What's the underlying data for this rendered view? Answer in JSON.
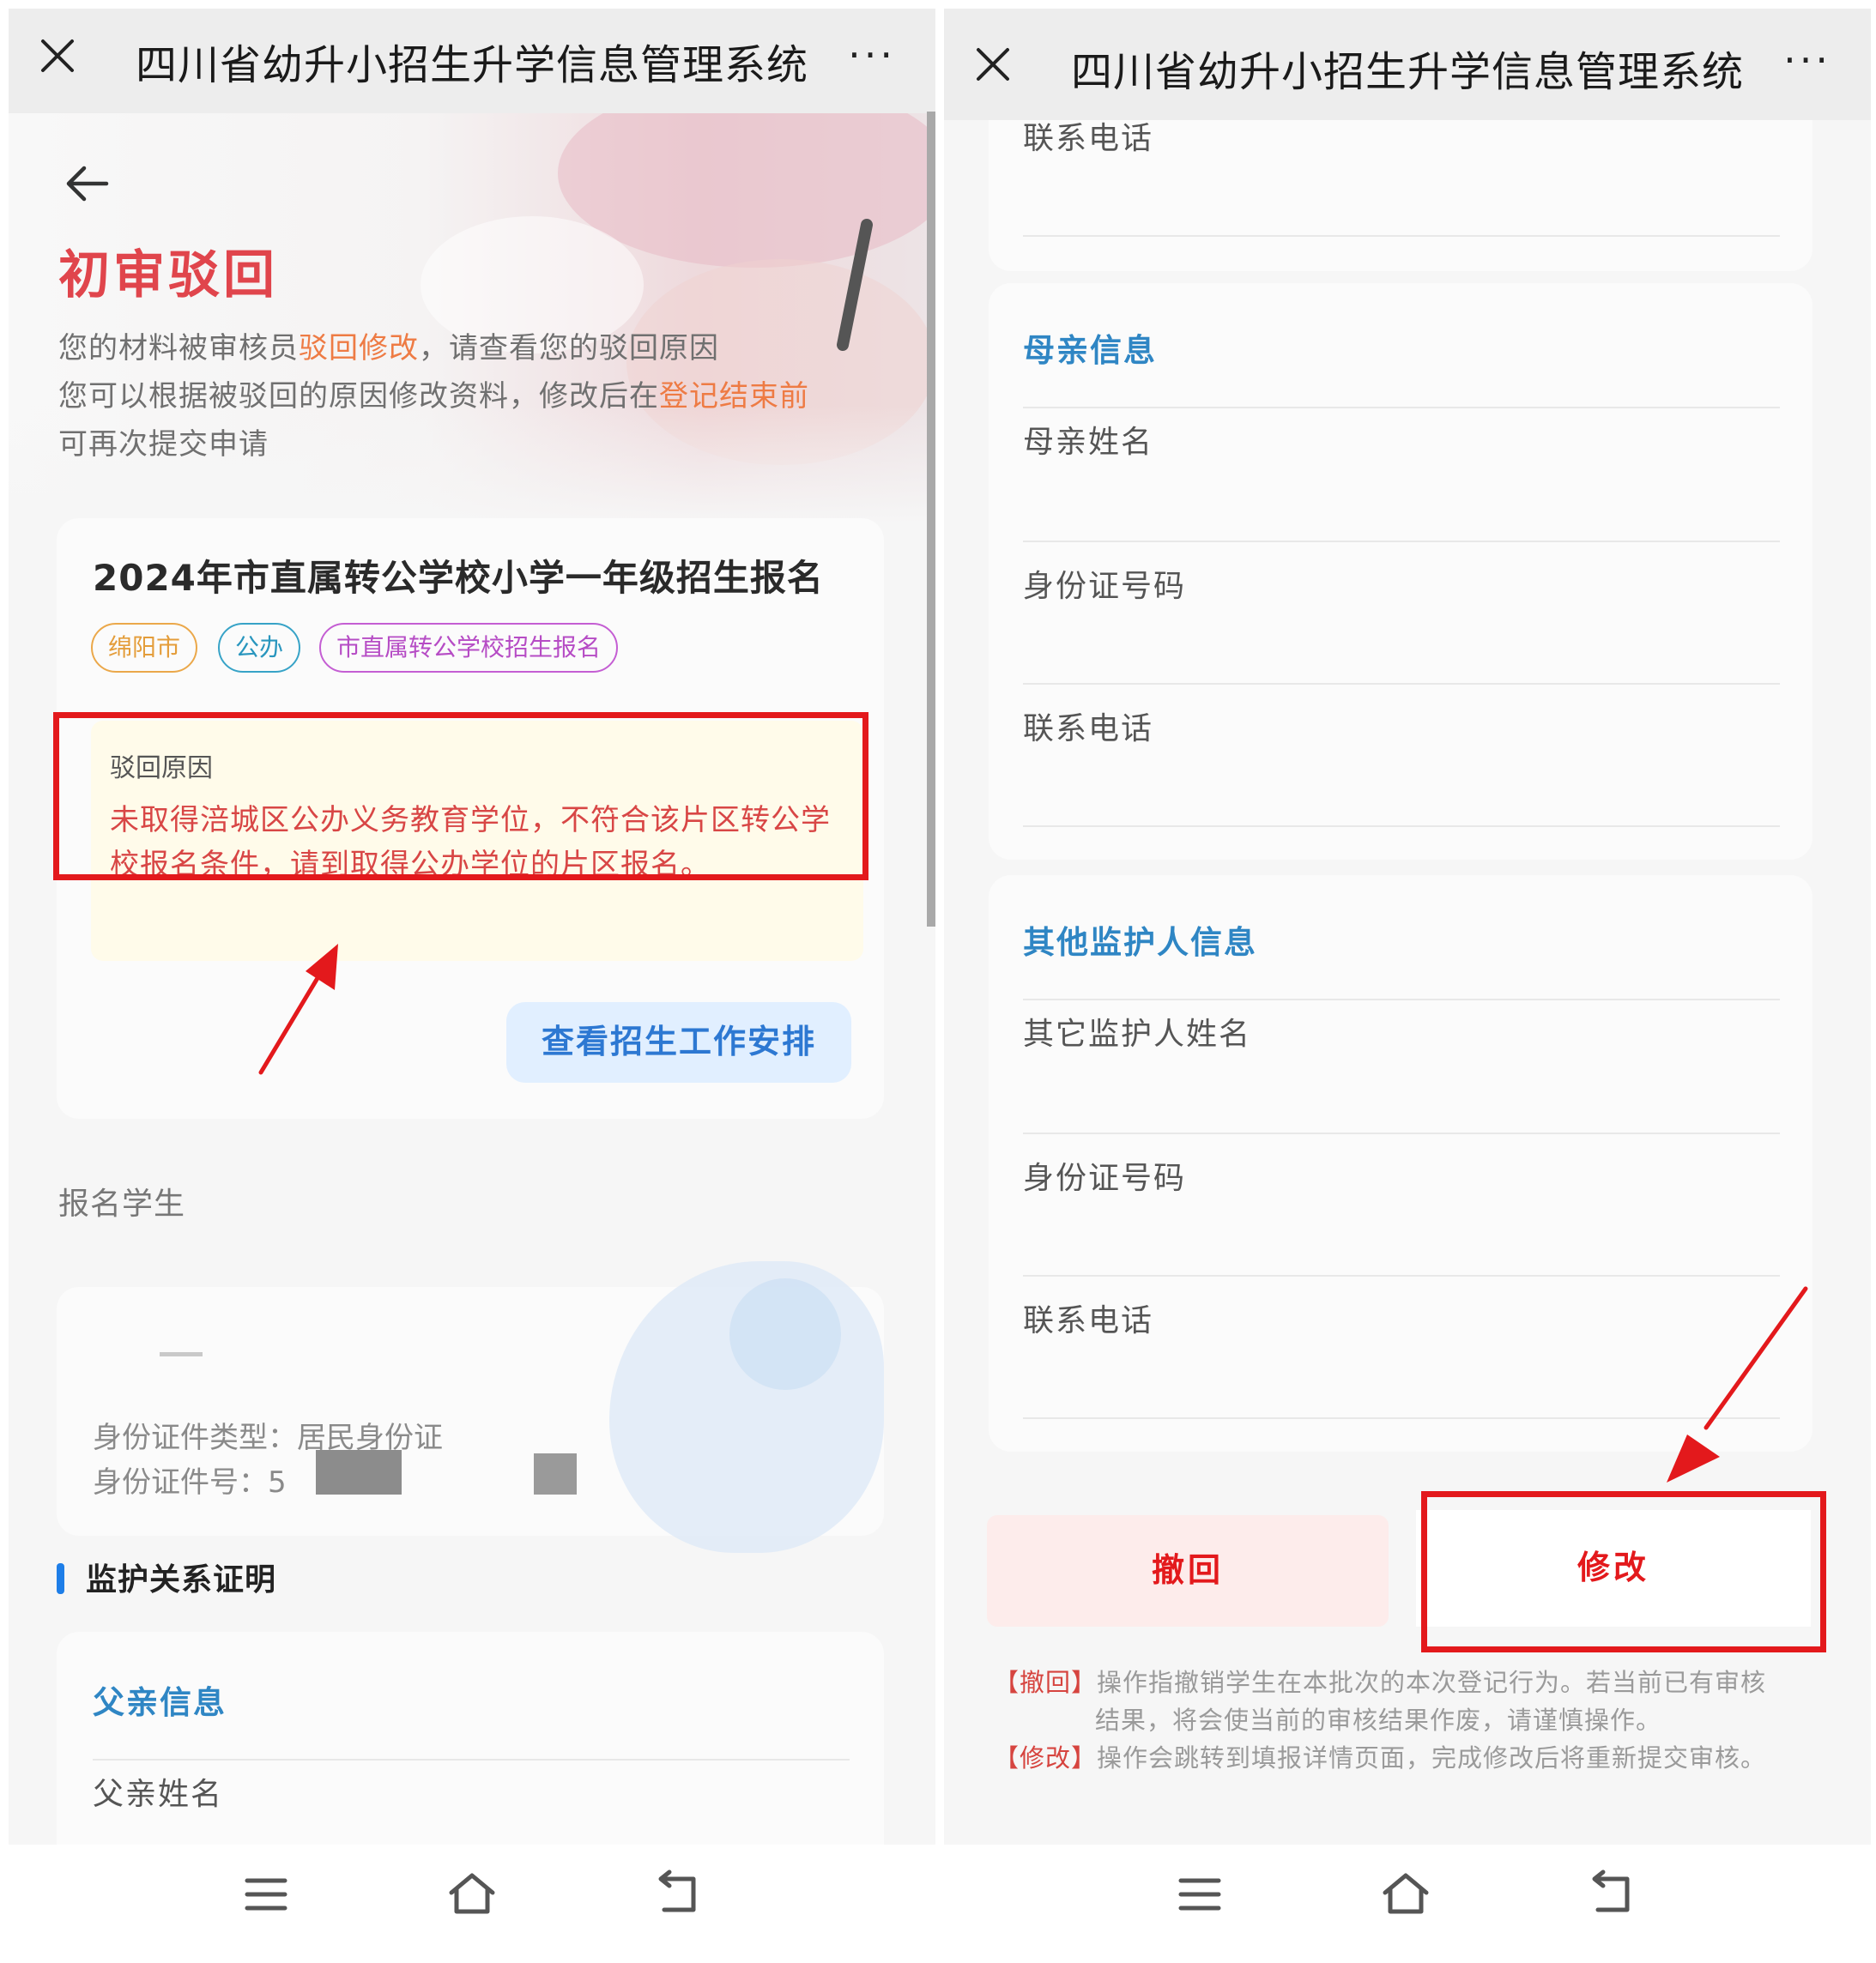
{
  "app": {
    "title": "四川省幼升小招生升学信息管理系统",
    "more": "···"
  },
  "left": {
    "status_title": "初审驳回",
    "desc": {
      "l1_a": "您的材料被审核员",
      "l1_hl": "驳回修改",
      "l1_b": "，请查看您的驳回原因",
      "l2_a": "您可以根据被驳回的原因修改资料，修改后在",
      "l2_hl": "登记结束前",
      "l3": "可再次提交申请"
    },
    "registration": {
      "title": "2024年市直属转公学校小学一年级招生报名",
      "tags": [
        "绵阳市",
        "公办",
        "市直属转公学校招生报名"
      ],
      "reason_label": "驳回原因",
      "reason_line1": "未取得涪城区公办义务教育学位，不符合该片区转公学",
      "reason_line2": "校报名条件，请到取得公办学位的片区报名。",
      "schedule_button": "查看招生工作安排"
    },
    "student": {
      "section_label": "报名学生",
      "id_type_label": "身份证件类型：",
      "id_type_value": "居民身份证",
      "id_number_label": "身份证件号：",
      "id_number_partial": "5"
    },
    "guardian": {
      "section_title": "监护关系证明",
      "father_header": "父亲信息",
      "father_name_label": "父亲姓名"
    }
  },
  "right": {
    "top_field": "联系电话",
    "mother": {
      "header": "母亲信息",
      "name": "母亲姓名",
      "id": "身份证号码",
      "phone": "联系电话"
    },
    "other": {
      "header": "其他监护人信息",
      "name": "其它监护人姓名",
      "id": "身份证号码",
      "phone": "联系电话"
    },
    "withdraw_button": "撤回",
    "modify_button": "修改",
    "notes": {
      "withdraw_tag": "【撤回】",
      "withdraw_l1": "操作指撤销学生在本批次的本次登记行为。若当前已有审核",
      "withdraw_l2": "结果，将会使当前的审核结果作废，请谨慎操作。",
      "modify_tag": "【修改】",
      "modify_l1": "操作会跳转到填报详情页面，完成修改后将重新提交审核。"
    }
  },
  "colors": {
    "reject_red": "#e0454c",
    "highlight_orange": "#ee7b44",
    "annotation_red": "#e3191c",
    "section_blue": "#2f86c4",
    "button_blue": "#2d78d2"
  }
}
